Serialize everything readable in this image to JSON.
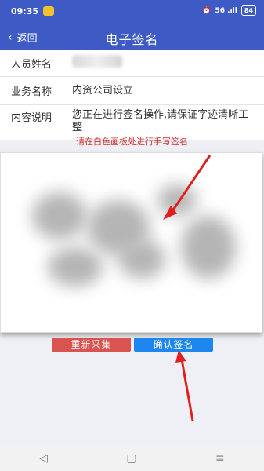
{
  "status_bar": {
    "time": "09:35",
    "right_text": "56 .ıll",
    "battery": "84"
  },
  "nav": {
    "back_label": "返回",
    "title": "电子签名"
  },
  "info": {
    "name_label": "人员姓名",
    "biz_label": "业务名称",
    "biz_value": "内资公司设立",
    "content_label": "内容说明",
    "content_value": "您正在进行签名操作,请保证字迹清晰工整"
  },
  "hint": "请在白色画板处进行手写签名",
  "buttons": {
    "retake": "重新采集",
    "confirm": "确认签名"
  },
  "bottom_nav": {
    "back_icon": "◁",
    "home_icon": "▢",
    "menu_icon": "≡"
  },
  "colors": {
    "primary": "#3e5ac4",
    "danger": "#d9534f",
    "confirm": "#1d87ef",
    "hint": "#cc3333"
  }
}
